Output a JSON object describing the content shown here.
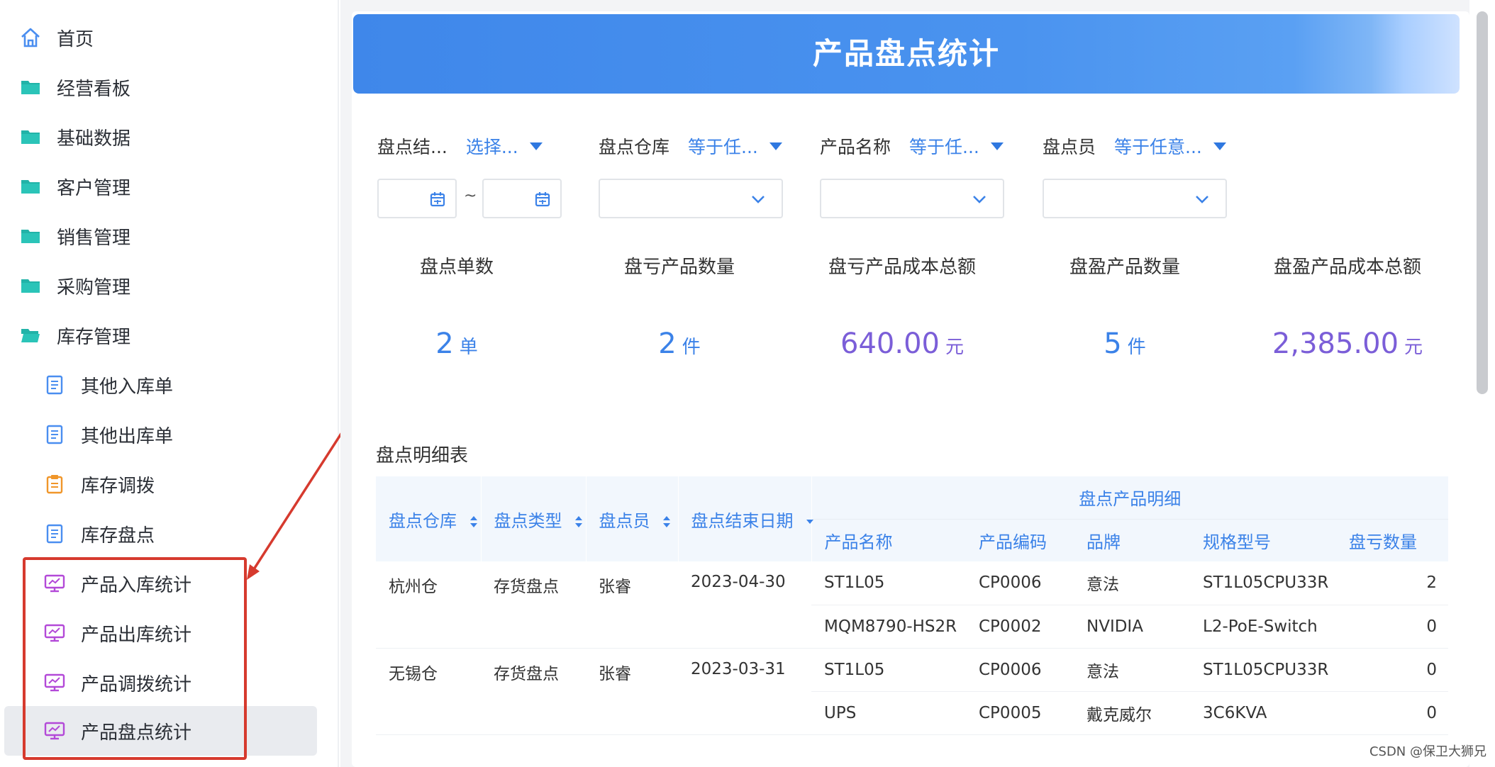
{
  "sidebar": {
    "items": [
      {
        "label": "首页",
        "icon": "home-icon",
        "level": 0
      },
      {
        "label": "经营看板",
        "icon": "folder-icon",
        "level": 0
      },
      {
        "label": "基础数据",
        "icon": "folder-icon",
        "level": 0
      },
      {
        "label": "客户管理",
        "icon": "folder-icon",
        "level": 0
      },
      {
        "label": "销售管理",
        "icon": "folder-icon",
        "level": 0
      },
      {
        "label": "采购管理",
        "icon": "folder-icon",
        "level": 0
      },
      {
        "label": "库存管理",
        "icon": "folder-icon",
        "level": 0
      },
      {
        "label": "其他入库单",
        "icon": "document-icon",
        "level": 1
      },
      {
        "label": "其他出库单",
        "icon": "document-icon",
        "level": 1
      },
      {
        "label": "库存调拨",
        "icon": "clipboard-icon",
        "level": 1
      },
      {
        "label": "库存盘点",
        "icon": "document-icon",
        "level": 1
      },
      {
        "label": "产品入库统计",
        "icon": "monitor-chart-icon",
        "level": 1
      },
      {
        "label": "产品出库统计",
        "icon": "monitor-chart-icon",
        "level": 1
      },
      {
        "label": "产品调拨统计",
        "icon": "monitor-chart-icon",
        "level": 1
      },
      {
        "label": "产品盘点统计",
        "icon": "monitor-chart-icon",
        "level": 1,
        "active": true
      }
    ]
  },
  "page": {
    "title": "产品盘点统计"
  },
  "filters": {
    "end_date": {
      "label": "盘点结...",
      "op": "选择..."
    },
    "warehouse": {
      "label": "盘点仓库",
      "op": "等于任..."
    },
    "product_name": {
      "label": "产品名称",
      "op": "等于任..."
    },
    "counter": {
      "label": "盘点员",
      "op": "等于任意..."
    },
    "date_separator": "~"
  },
  "stats": [
    {
      "label": "盘点单数",
      "value": "2",
      "unit": "单",
      "color": "#3b82e8"
    },
    {
      "label": "盘亏产品数量",
      "value": "2",
      "unit": "件",
      "color": "#3b82e8"
    },
    {
      "label": "盘亏产品成本总额",
      "value": "640.00",
      "unit": "元",
      "color": "#7b5ed8"
    },
    {
      "label": "盘盈产品数量",
      "value": "5",
      "unit": "件",
      "color": "#3b82e8"
    },
    {
      "label": "盘盈产品成本总额",
      "value": "2,385.00",
      "unit": "元",
      "color": "#7b5ed8"
    }
  ],
  "table": {
    "title": "盘点明细表",
    "group_header": "盘点产品明细",
    "left_headers": [
      "盘点仓库",
      "盘点类型",
      "盘点员",
      "盘点结束日期"
    ],
    "detail_headers": [
      "产品名称",
      "产品编码",
      "品牌",
      "规格型号",
      "盘亏数量"
    ],
    "groups": [
      {
        "warehouse": "杭州仓",
        "type": "存货盘点",
        "counter": "张睿",
        "end_date": "2023-04-30",
        "rows": [
          {
            "name": "ST1L05",
            "code": "CP0006",
            "brand": "意法",
            "spec": "ST1L05CPU33R",
            "loss": "2"
          },
          {
            "name": "MQM8790-HS2R",
            "code": "CP0002",
            "brand": "NVIDIA",
            "spec": "L2-PoE-Switch",
            "loss": "0"
          }
        ]
      },
      {
        "warehouse": "无锡仓",
        "type": "存货盘点",
        "counter": "张睿",
        "end_date": "2023-03-31",
        "rows": [
          {
            "name": "ST1L05",
            "code": "CP0006",
            "brand": "意法",
            "spec": "ST1L05CPU33R",
            "loss": "0"
          },
          {
            "name": "UPS",
            "code": "CP0005",
            "brand": "戴克威尔",
            "spec": "3C6KVA",
            "loss": "0"
          }
        ]
      }
    ]
  },
  "watermark": "CSDN @保卫大狮兄",
  "colors": {
    "accent": "#3b82e8",
    "purple": "#7b5ed8",
    "highlight_box": "#d63a2e"
  }
}
